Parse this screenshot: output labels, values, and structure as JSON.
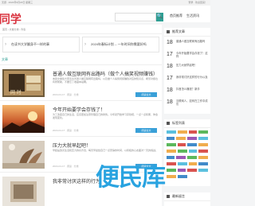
{
  "topbar": {
    "left": "无题 · 2024年9月18日 星期三",
    "right": "登录 · 欢迎回来！"
  },
  "header": {
    "logo": "·同学",
    "search_btn": "🔍",
    "nav": [
      "首页推荐",
      "生活资讯"
    ]
  },
  "breadcrumb": "首页 › 文章分类 › 列表",
  "featured": [
    {
      "label": "在读书大学翻身不一样的事"
    },
    {
      "label": "2024年春标计划 -- 一年时间你需要好吗"
    }
  ],
  "list_title": "文章",
  "articles": [
    {
      "title": "普通人做互联网有出路吗（做个人搞笑视频赚钱）",
      "summary": "本篇文章给大家谈谈普通人做互联网有出路吗，以及做个人搞笑视频赚钱对应的知识点，希望对各位有所帮助，不要忘了收藏本站喔。",
      "meta": "2024-01-17 · 阅读 · 分类",
      "more": "阅读全文"
    },
    {
      "title": "今年开始要学会存钱了！",
      "summary": "为了改变自己的生活，应该更加注意管理自己的财务。今年就开始学习存钱吧，一点一点积累，你会发现变化。",
      "meta": "2024-01-17 · 阅读 · 分类",
      "more": "阅读全文"
    },
    {
      "title": "压力大就早起吧！",
      "summary": "早起是改善生活和压力的好方法，每天早晨给自己一点安静的时间，以积极的心态面对一天的挑战。",
      "meta": "2024-01-17 · 阅读 · 分类",
      "more": "阅读全文"
    },
    {
      "title": "我非常讨厌这样的行为",
      "summary": "",
      "meta": "",
      "more": ""
    }
  ],
  "sidebar": {
    "hot_title": "推荐文章",
    "hot": [
      {
        "num": "18",
        "text": "普通人做互联网有出路吗"
      },
      {
        "num": "17",
        "text": "今年开始要学会存钱了！这样"
      },
      {
        "num": "18",
        "text": "压力大就早起吧！"
      },
      {
        "num": "17",
        "text": "我非常讨厌这样的行为以及"
      },
      {
        "num": "18",
        "text": "抖音怎么赚钱？新手"
      },
      {
        "num": "18",
        "text": "互联网人，如何在工作中成长"
      }
    ],
    "tags_title": "标签列表",
    "third_title": "最新留言"
  },
  "colors": {
    "accent": "#2f9f94",
    "brand": "#d9333f",
    "more_btn": "#3aa0d8"
  },
  "watermark": "便民库"
}
